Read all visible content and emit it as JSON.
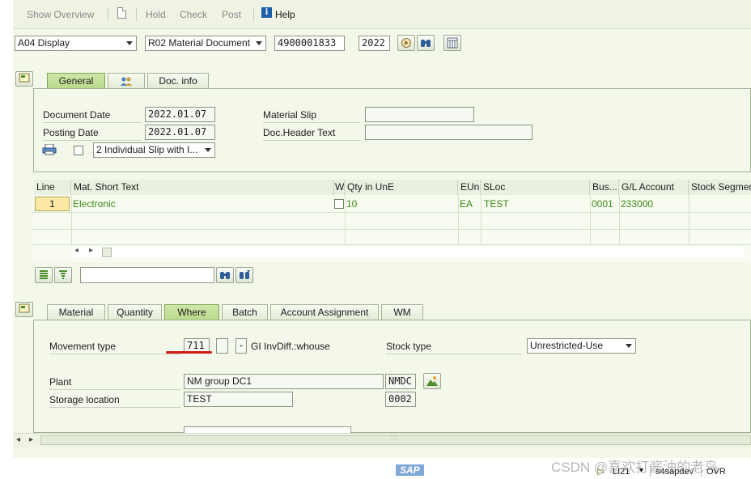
{
  "toolbar": {
    "show_overview": "Show Overview",
    "hold": "Hold",
    "check": "Check",
    "post": "Post",
    "help": "Help"
  },
  "header": {
    "action": "A04 Display",
    "reference": "R02 Material Document",
    "doc_number": "4900001833",
    "year": "2022"
  },
  "header_tabs": [
    "General",
    "Doc. info"
  ],
  "general": {
    "document_date_label": "Document Date",
    "document_date": "2022.01.07",
    "posting_date_label": "Posting Date",
    "posting_date": "2022.01.07",
    "material_slip_label": "Material Slip",
    "material_slip": "",
    "doc_header_text_label": "Doc.Header Text",
    "doc_header_text": "",
    "print_version": "2 Individual Slip with I..."
  },
  "items_table": {
    "columns": [
      "Line",
      "Mat. Short Text",
      "W",
      "Qty in UnE",
      "EUn",
      "SLoc",
      "Bus...",
      "G/L Account",
      "Stock Segment"
    ],
    "rows": [
      {
        "line": "1",
        "text": "Electronic",
        "qty": "10",
        "eun": "EA",
        "sloc": "TEST",
        "bus": "0001",
        "gl": "233000",
        "segment": ""
      }
    ]
  },
  "detail_tabs": [
    "Material",
    "Quantity",
    "Where",
    "Batch",
    "Account Assignment",
    "WM"
  ],
  "where": {
    "movement_type_label": "Movement type",
    "movement_type": "711",
    "special_stock": "",
    "direction": "-",
    "movement_desc": "GI InvDiff.:whouse",
    "stock_type_label": "Stock type",
    "stock_type": "Unrestricted-Use",
    "plant_label": "Plant",
    "plant_name": "NM group DC1",
    "plant_code": "NMDC",
    "storage_location_label": "Storage location",
    "storage_location_name": "TEST",
    "storage_location_code": "0002"
  },
  "status": {
    "sap_logo": "SAP",
    "transaction": "LI21",
    "system": "s4sapdev",
    "mode": "OVR",
    "watermark": "CSDN @喜欢打酱油的老鸟"
  },
  "colors": {
    "frame_bg": "#f3f8ea",
    "active_tab": "#b9d98a",
    "item_text": "#3b8a16",
    "annotation": "#d11a1a"
  }
}
